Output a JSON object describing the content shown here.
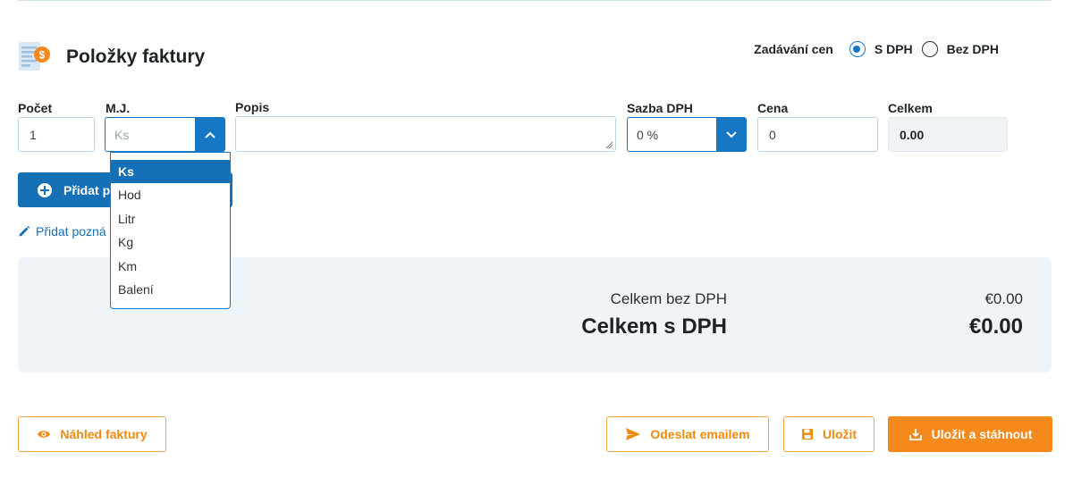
{
  "section": {
    "title": "Položky faktury",
    "icon": "invoice-coin-icon"
  },
  "price_entry": {
    "label": "Zadávání cen",
    "options": [
      {
        "label": "S DPH",
        "checked": true
      },
      {
        "label": "Bez DPH",
        "checked": false
      }
    ]
  },
  "fields": {
    "count_label": "Počet",
    "count_value": "1",
    "unit_label": "M.J.",
    "unit_placeholder": "Ks",
    "description_label": "Popis",
    "description_value": "",
    "vat_label": "Sazba DPH",
    "vat_value": "0 %",
    "price_label": "Cena",
    "price_value": "0",
    "total_label": "Celkem",
    "total_value": "0.00"
  },
  "unit_dropdown": {
    "options": [
      "Ks",
      "Hod",
      "Litr",
      "Kg",
      "Km",
      "Balení"
    ],
    "selected": "Ks"
  },
  "actions": {
    "add_item_label": "Přidat p",
    "add_note_label": "Přidat pozná"
  },
  "summary": {
    "without_vat_label": "Celkem bez DPH",
    "without_vat_value": "€0.00",
    "with_vat_label": "Celkem s DPH",
    "with_vat_value": "€0.00"
  },
  "footer": {
    "preview_label": "Náhled faktury",
    "send_email_label": "Odeslat emailem",
    "save_label": "Uložit",
    "save_download_label": "Uložit a stáhnout"
  },
  "colors": {
    "primary_blue": "#1670b5",
    "orange": "#f5891c",
    "summary_bg": "#eef4f8"
  }
}
